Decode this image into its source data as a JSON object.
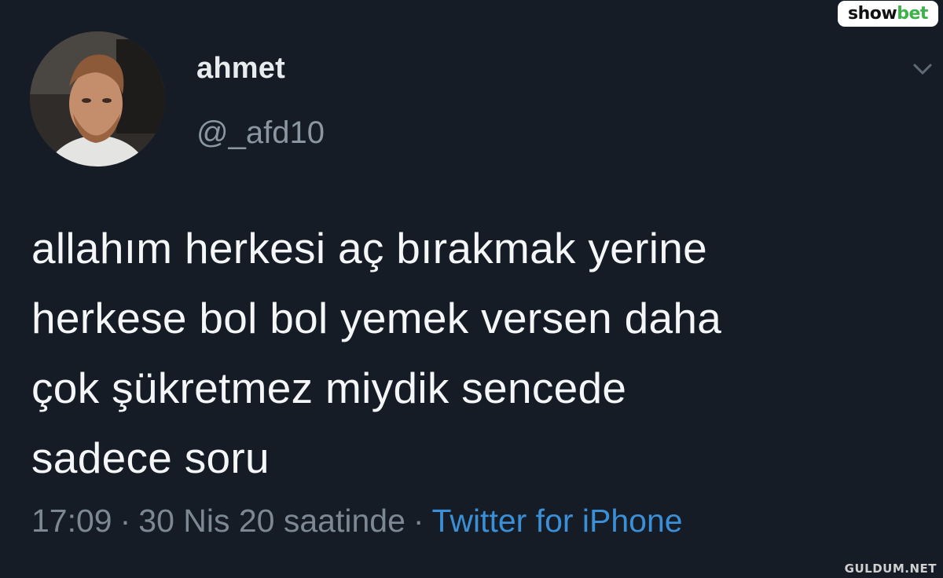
{
  "author": {
    "display_name": "ahmet",
    "handle": "@_afd10"
  },
  "tweet": {
    "lines": [
      "allahım herkesi aç bırakmak yerine",
      "herkese bol bol yemek versen daha",
      "çok şükretmez miydik sencede",
      "sadece soru"
    ]
  },
  "meta": {
    "time": "17:09",
    "separator": "·",
    "date": "30 Nis 20 saatinde",
    "source": "Twitter for iPhone"
  },
  "overlay": {
    "brand_part_a": "show",
    "brand_part_b": "bet",
    "watermark": "GULDUM.NET"
  },
  "icons": {
    "menu": "chevron-down-icon"
  },
  "colors": {
    "background": "#151c25",
    "link": "#3a8fd6",
    "muted": "#7c8893"
  }
}
